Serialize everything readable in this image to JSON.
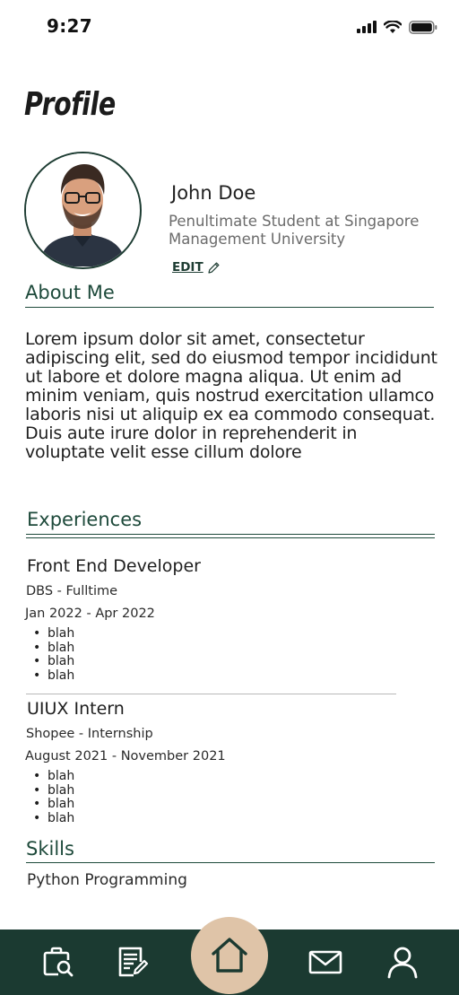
{
  "status_bar": {
    "time": "9:27"
  },
  "header": {
    "title": "Profile"
  },
  "profile": {
    "name": "John Doe",
    "subtitle": "Penultimate Student at Singapore Management University",
    "edit_label": "EDIT"
  },
  "about": {
    "heading": "About Me",
    "body": "Lorem ipsum dolor sit amet, consectetur adipiscing elit, sed do eiusmod tempor incididunt ut labore et dolore magna aliqua. Ut enim ad minim veniam, quis nostrud exercitation ullamco laboris nisi ut aliquip ex ea commodo consequat. Duis aute irure dolor in reprehenderit in voluptate velit esse cillum dolore"
  },
  "experiences": {
    "heading": "Experiences",
    "items": [
      {
        "title": "Front End Developer",
        "company": "DBS - Fulltime",
        "dates": "Jan 2022 - Apr 2022",
        "bullets": [
          "blah",
          "blah",
          "blah",
          "blah"
        ]
      },
      {
        "title": "UIUX Intern",
        "company": "Shopee - Internship",
        "dates": "August 2021 -  November 2021",
        "bullets": [
          "blah",
          "blah",
          "blah",
          "blah"
        ]
      }
    ]
  },
  "skills": {
    "heading": "Skills",
    "items": [
      "Python Programming"
    ]
  },
  "nav": {
    "items": [
      "job-search-icon",
      "resume-icon",
      "home-icon",
      "mail-icon",
      "user-icon"
    ],
    "active": "home-icon"
  },
  "colors": {
    "accent": "#1e4a3b",
    "nav_background": "#1b3a31",
    "home_button": "#dfc4a8"
  }
}
